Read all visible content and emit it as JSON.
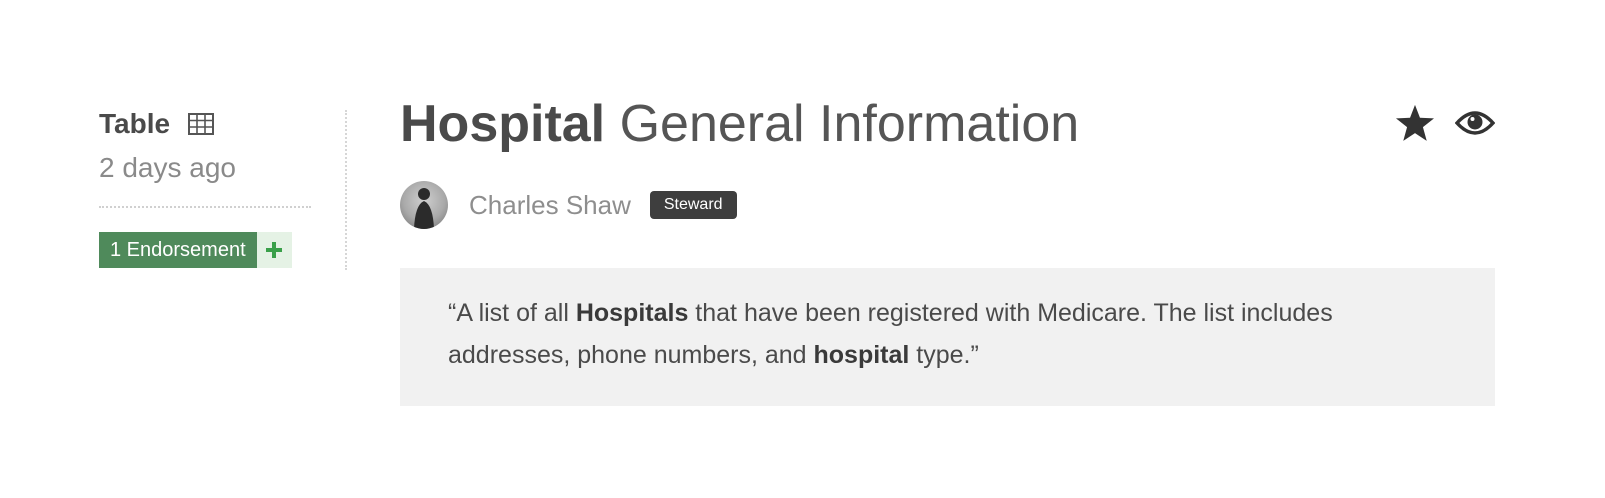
{
  "dataset": {
    "type_label": "Table",
    "age": "2 days ago",
    "endorsements": {
      "count_label": "1 Endorsement",
      "add_icon": "plus-icon"
    },
    "title": {
      "strong": "Hospital",
      "rest": " General Information"
    },
    "actions": {
      "favorite_icon": "star-icon",
      "watch_icon": "eye-icon"
    },
    "author": {
      "name": "Charles Shaw",
      "role_badge": "Steward"
    },
    "description": {
      "open_quote": "“A list of all ",
      "term1": "Hospitals",
      "mid": " that have been registered with Medicare. The list includes addresses, phone numbers, and ",
      "term2": "hospital",
      "end": " type.”"
    }
  },
  "colors": {
    "endorse_green": "#4f8a5b",
    "endorse_add_bg": "#e5f2e5",
    "badge_bg": "#3e3e3e",
    "description_bg": "#f1f1f1"
  }
}
